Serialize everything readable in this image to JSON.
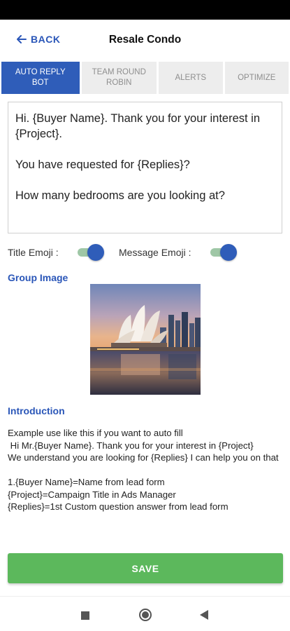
{
  "header": {
    "back_label": "BACK",
    "title": "Resale Condo"
  },
  "tabs": [
    {
      "label": "AUTO REPLY BOT",
      "active": true
    },
    {
      "label": "TEAM ROUND ROBIN",
      "active": false
    },
    {
      "label": "ALERTS",
      "active": false
    },
    {
      "label": "OPTIMIZE",
      "active": false
    }
  ],
  "message": {
    "line1": "Hi. {Buyer Name}. Thank you for your interest in {Project}.",
    "line2": "You have requested for {Replies}?",
    "line3": "How many bedrooms are you looking at?"
  },
  "emoji": {
    "title_label": "Title Emoji :",
    "title_on": true,
    "message_label": "Message Emoji :",
    "message_on": true
  },
  "group_image": {
    "label": "Group Image",
    "icon": "marina-bay-skyline-photo"
  },
  "introduction": {
    "label": "Introduction",
    "line1": "Example use like this if you want to auto fill",
    "line2": " Hi Mr.{Buyer Name}. Thank you for your interest in {Project}",
    "line3": "We understand you are looking for {Replies} I can help you on that",
    "line4": "1.{Buyer Name}=Name from lead form",
    "line5": "{Project}=Campaign Title in Ads Manager",
    "line6": "{Replies}=1st Custom question answer from lead form"
  },
  "save_label": "SAVE",
  "colors": {
    "accent": "#2f5db9",
    "link": "#2a56b8",
    "save": "#5cb85c",
    "toggle_track": "#9fc7a6"
  },
  "nav": {
    "recents_icon": "square-icon",
    "home_icon": "circle-icon",
    "back_icon": "triangle-back-icon"
  }
}
